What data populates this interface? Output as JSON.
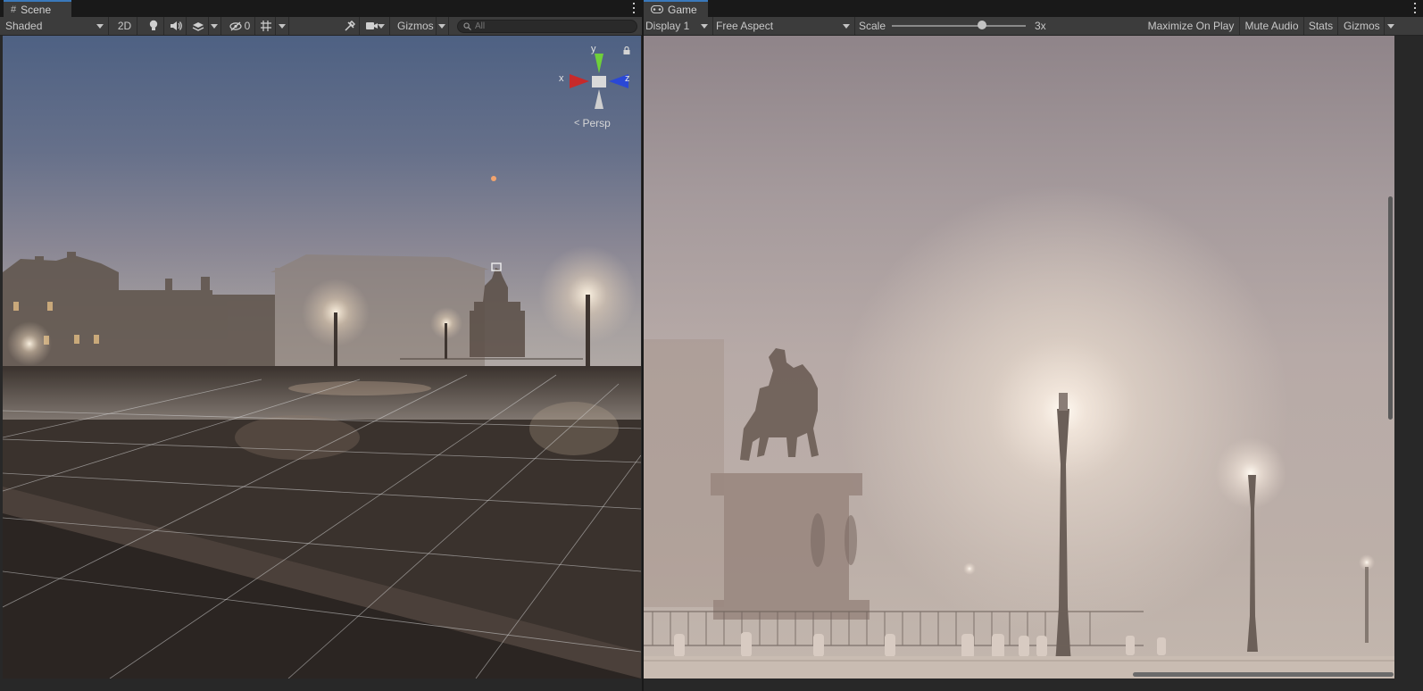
{
  "scene": {
    "tab_label": "Scene",
    "tab_icon": "grid-icon",
    "shading_mode": "Shaded",
    "btn_2d": "2D",
    "hidden_count": "0",
    "gizmos_label": "Gizmos",
    "search_placeholder": "All",
    "axis_x": "x",
    "axis_y": "y",
    "axis_z": "z",
    "projection": "Persp"
  },
  "game": {
    "tab_label": "Game",
    "tab_icon": "gamepad-icon",
    "display": "Display 1",
    "aspect": "Free Aspect",
    "scale_label": "Scale",
    "scale_value": "3x",
    "scale_fraction": 0.67,
    "maximize_on_play": "Maximize On Play",
    "mute_audio": "Mute Audio",
    "stats": "Stats",
    "gizmos_label": "Gizmos"
  },
  "colors": {
    "tab_accent": "#3a79bb",
    "toolbar_bg": "#3c3c3c",
    "axis_x": "#c72a2a",
    "axis_y": "#6fd03a",
    "axis_z": "#2a48d6"
  }
}
